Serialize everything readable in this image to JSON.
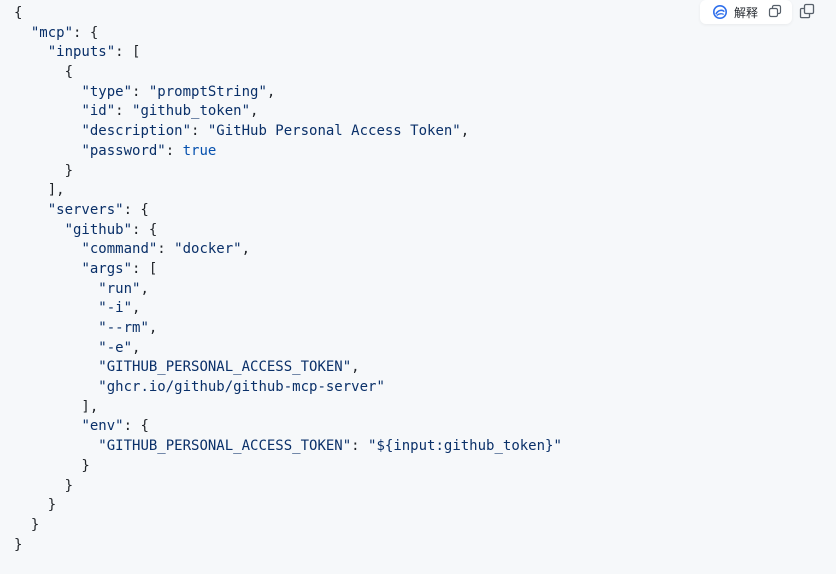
{
  "toolbar": {
    "explain_label": "解释",
    "explain_icon": "ai-swirl-icon",
    "copy_icon_small": "copy-icon",
    "copy_icon_large": "copy-icon"
  },
  "colors": {
    "code_text": "#1f2328",
    "string": "#0a3069",
    "keyword": "#0550ae",
    "background": "#f6f8fa",
    "accent": "#2f6feb"
  },
  "code": {
    "lines": [
      "{",
      "  \"mcp\": {",
      "    \"inputs\": [",
      "      {",
      "        \"type\": \"promptString\",",
      "        \"id\": \"github_token\",",
      "        \"description\": \"GitHub Personal Access Token\",",
      "        \"password\": true",
      "      }",
      "    ],",
      "    \"servers\": {",
      "      \"github\": {",
      "        \"command\": \"docker\",",
      "        \"args\": [",
      "          \"run\",",
      "          \"-i\",",
      "          \"--rm\",",
      "          \"-e\",",
      "          \"GITHUB_PERSONAL_ACCESS_TOKEN\",",
      "          \"ghcr.io/github/github-mcp-server\"",
      "        ],",
      "        \"env\": {",
      "          \"GITHUB_PERSONAL_ACCESS_TOKEN\": \"${input:github_token}\"",
      "        }",
      "      }",
      "    }",
      "  }",
      "}"
    ]
  }
}
